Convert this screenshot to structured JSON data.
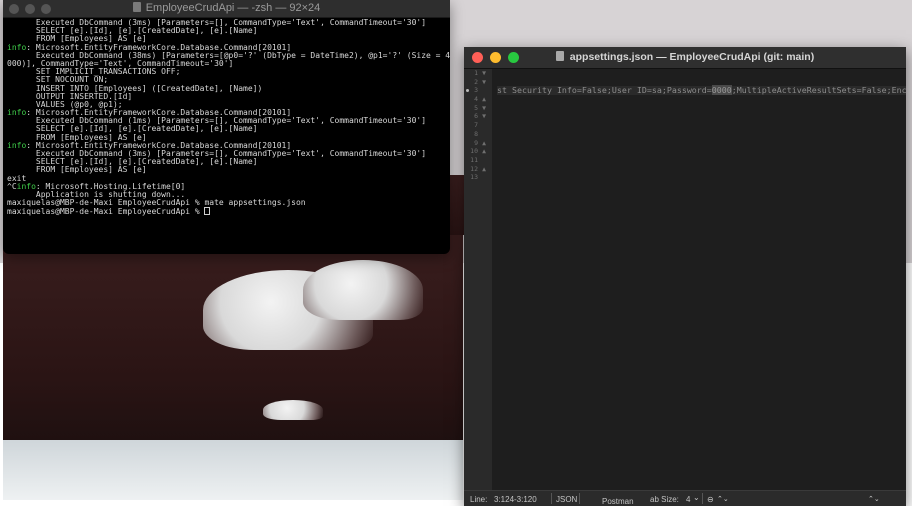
{
  "colors": {
    "terminal_bg": "#000000",
    "terminal_text": "#d8d8d8",
    "info_green": "#3fcf4a",
    "editor_bg": "#1e1e1e",
    "traffic_red": "#ff5f57",
    "traffic_yellow": "#febc2e",
    "traffic_green": "#28c840"
  },
  "terminal": {
    "title": "EmployeeCrudApi — -zsh — 92×24",
    "lines": [
      {
        "tag": "",
        "text": "      Executed DbCommand (3ms) [Parameters=[], CommandType='Text', CommandTimeout='30']"
      },
      {
        "tag": "",
        "text": "      SELECT [e].[Id], [e].[CreatedDate], [e].[Name]"
      },
      {
        "tag": "",
        "text": "      FROM [Employees] AS [e]"
      },
      {
        "tag": "info",
        "text": ": Microsoft.EntityFrameworkCore.Database.Command[20101]"
      },
      {
        "tag": "",
        "text": "      Executed DbCommand (38ms) [Parameters=[@p0='?' (DbType = DateTime2), @p1='?' (Size = 4"
      },
      {
        "tag": "",
        "text": "000)], CommandType='Text', CommandTimeout='30']"
      },
      {
        "tag": "",
        "text": "      SET IMPLICIT_TRANSACTIONS OFF;"
      },
      {
        "tag": "",
        "text": "      SET NOCOUNT ON;"
      },
      {
        "tag": "",
        "text": "      INSERT INTO [Employees] ([CreatedDate], [Name])"
      },
      {
        "tag": "",
        "text": "      OUTPUT INSERTED.[Id]"
      },
      {
        "tag": "",
        "text": "      VALUES (@p0, @p1);"
      },
      {
        "tag": "info",
        "text": ": Microsoft.EntityFrameworkCore.Database.Command[20101]"
      },
      {
        "tag": "",
        "text": "      Executed DbCommand (1ms) [Parameters=[], CommandType='Text', CommandTimeout='30']"
      },
      {
        "tag": "",
        "text": "      SELECT [e].[Id], [e].[CreatedDate], [e].[Name]"
      },
      {
        "tag": "",
        "text": "      FROM [Employees] AS [e]"
      },
      {
        "tag": "info",
        "text": ": Microsoft.EntityFrameworkCore.Database.Command[20101]"
      },
      {
        "tag": "",
        "text": "      Executed DbCommand (3ms) [Parameters=[], CommandType='Text', CommandTimeout='30']"
      },
      {
        "tag": "",
        "text": "      SELECT [e].[Id], [e].[CreatedDate], [e].[Name]"
      },
      {
        "tag": "",
        "text": "      FROM [Employees] AS [e]"
      },
      {
        "tag": "",
        "text": "exit"
      },
      {
        "tag": "^Cinfo",
        "text": ": Microsoft.Hosting.Lifetime[0]"
      },
      {
        "tag": "",
        "text": "      Application is shutting down..."
      },
      {
        "tag": "",
        "text": "maxiquelas@MBP-de-Maxi EmployeeCrudApi % mate appsettings.json"
      }
    ],
    "prompt": "maxiquelas@MBP-de-Maxi EmployeeCrudApi % "
  },
  "editor": {
    "title": "appsettings.json — EmployeeCrudApi (git: main)",
    "gutter": [
      {
        "num": "1",
        "fold": "▼"
      },
      {
        "num": "2",
        "fold": "▼"
      },
      {
        "num": "3",
        "fold": ""
      },
      {
        "num": "4",
        "fold": "▲"
      },
      {
        "num": "5",
        "fold": "▼"
      },
      {
        "num": "6",
        "fold": "▼"
      },
      {
        "num": "7",
        "fold": ""
      },
      {
        "num": "8",
        "fold": ""
      },
      {
        "num": "9",
        "fold": "▲"
      },
      {
        "num": "10",
        "fold": "▲"
      },
      {
        "num": "11",
        "fold": ""
      },
      {
        "num": "12",
        "fold": "▲"
      },
      {
        "num": "13",
        "fold": ""
      }
    ],
    "code_line_3_before": "st Security Info=False;User ID=sa;Password=",
    "code_line_3_masked": "0000",
    "code_line_3_after": ";MultipleActiveResultSets=False;Encry",
    "status": {
      "line_label": "Line:",
      "line_value": "3:124-3:120",
      "language": "JSON",
      "bundle": "Postman",
      "tab_size_label": "ab Size:",
      "tab_size_value": "4",
      "tab_chevron": "⌄",
      "settings_glyph": "⊖",
      "stepper_glyph": "⌃⌄"
    }
  }
}
